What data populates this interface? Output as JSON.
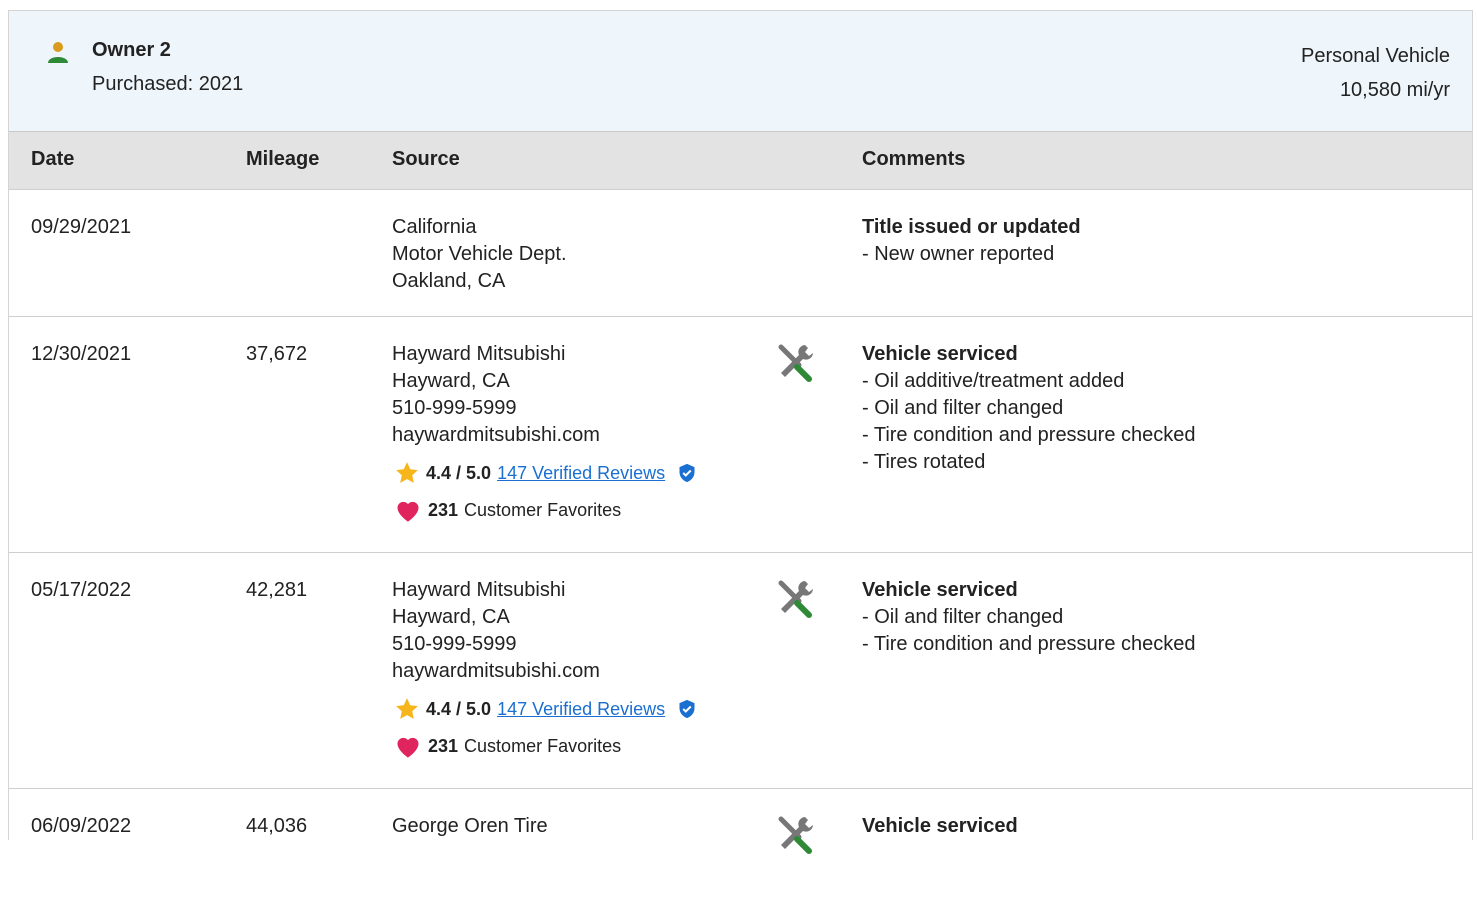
{
  "owner": {
    "title": "Owner 2",
    "purchased": "Purchased: 2021",
    "vehicle_type": "Personal Vehicle",
    "mileage_per_year": "10,580 mi/yr",
    "icon": "person-icon",
    "icon_color": "#2e8a36"
  },
  "table": {
    "headers": {
      "date": "Date",
      "mileage": "Mileage",
      "source": "Source",
      "comments": "Comments"
    },
    "rows": [
      {
        "date": "09/29/2021",
        "mileage": "",
        "source": [
          "California",
          "Motor Vehicle Dept.",
          "Oakland, CA"
        ],
        "comment_title": "Title issued or updated",
        "comment_items": [
          "- New owner reported"
        ]
      },
      {
        "date": "12/30/2021",
        "mileage": "37,672",
        "source": [
          "Hayward Mitsubishi",
          "Hayward, CA",
          "510-999-5999",
          "haywardmitsubishi.com"
        ],
        "rating": {
          "score": "4.4 / 5.0",
          "reviews_link": "147 Verified Reviews"
        },
        "favorites": {
          "count": "231",
          "label": "Customer Favorites"
        },
        "service_icon": "wrench-screwdriver-icon",
        "comment_title": "Vehicle serviced",
        "comment_items": [
          "- Oil additive/treatment added",
          "- Oil and filter changed",
          "- Tire condition and pressure checked",
          "- Tires rotated"
        ]
      },
      {
        "date": "05/17/2022",
        "mileage": "42,281",
        "source": [
          "Hayward Mitsubishi",
          "Hayward, CA",
          "510-999-5999",
          "haywardmitsubishi.com"
        ],
        "rating": {
          "score": "4.4 / 5.0",
          "reviews_link": "147 Verified Reviews"
        },
        "favorites": {
          "count": "231",
          "label": "Customer Favorites"
        },
        "service_icon": "wrench-screwdriver-icon",
        "comment_title": "Vehicle serviced",
        "comment_items": [
          "- Oil and filter changed",
          "- Tire condition and pressure checked"
        ]
      },
      {
        "date": "06/09/2022",
        "mileage": "44,036",
        "source": [
          "George Oren Tire"
        ],
        "service_icon": "wrench-screwdriver-icon",
        "comment_title": "Vehicle serviced",
        "comment_items": []
      }
    ]
  },
  "colors": {
    "star": "#f6b51b",
    "heart": "#e0245e",
    "link": "#1a6fd1",
    "service_green": "#2e8a36",
    "header_bg": "#eef5fb"
  }
}
